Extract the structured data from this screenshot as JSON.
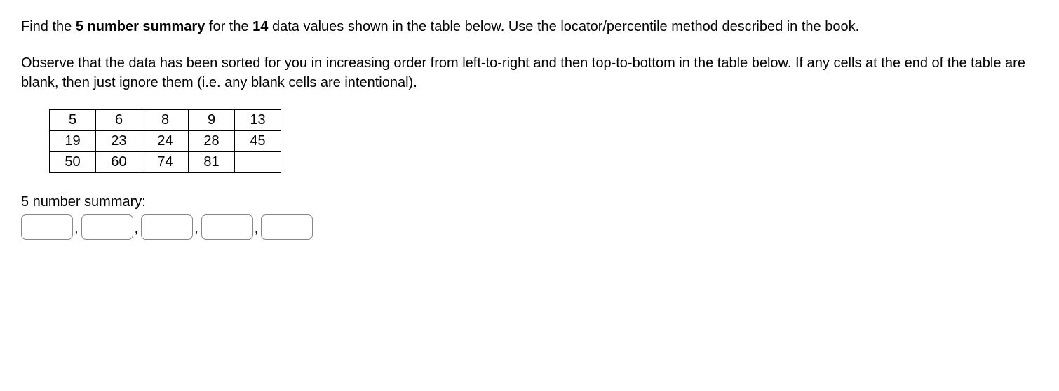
{
  "question": {
    "p1_part1": "Find the ",
    "p1_bold1": "5 number summary",
    "p1_part2": " for the ",
    "p1_bold2": "14",
    "p1_part3": " data values shown in the table below.  Use the locator/percentile method described in the book.",
    "p2": "Observe that the data has been sorted for you in increasing order from left-to-right and then top-to-bottom in the table below.  If any cells at the end of the table are blank, then just ignore them (i.e. any blank cells are intentional)."
  },
  "table": {
    "rows": [
      [
        "5",
        "6",
        "8",
        "9",
        "13"
      ],
      [
        "19",
        "23",
        "24",
        "28",
        "45"
      ],
      [
        "50",
        "60",
        "74",
        "81",
        ""
      ]
    ]
  },
  "answer": {
    "label": "5 number summary:",
    "comma": ",",
    "values": [
      "",
      "",
      "",
      "",
      ""
    ]
  }
}
